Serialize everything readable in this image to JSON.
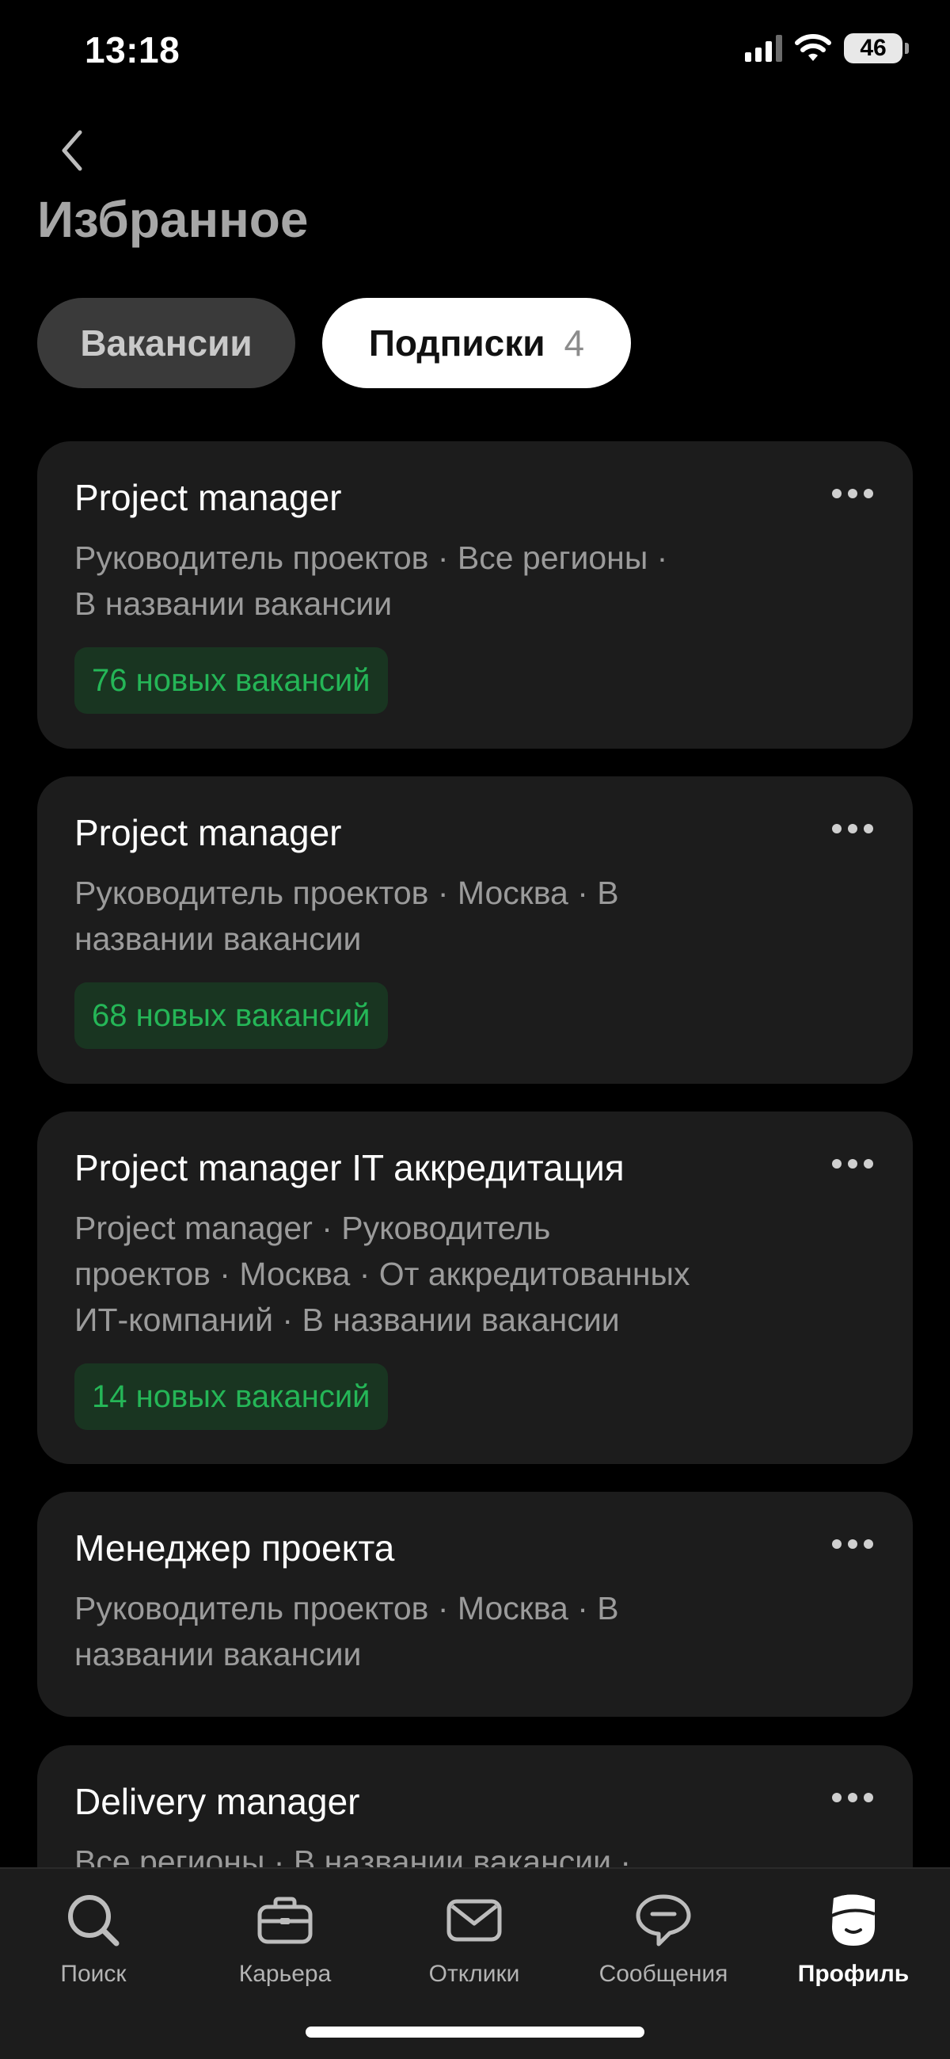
{
  "status_bar": {
    "time": "13:18",
    "battery": "46"
  },
  "header": {
    "back_icon": "chevron-left-icon",
    "title": "Избранное"
  },
  "tabs": [
    {
      "label": "Вакансии",
      "active": false
    },
    {
      "label": "Подписки",
      "count": "4",
      "active": true
    }
  ],
  "subscriptions": [
    {
      "title": "Project manager",
      "desc_lines": [
        "Руководитель проектов · Все регионы ·",
        "В названии вакансии"
      ],
      "badge": "76 новых вакансий"
    },
    {
      "title": "Project manager",
      "desc_lines": [
        "Руководитель проектов · Москва · В",
        "названии вакансии"
      ],
      "badge": "68 новых вакансий"
    },
    {
      "title": "Project manager IT аккредитация",
      "desc_lines": [
        "Project manager · Руководитель",
        "проектов · Москва · От аккредитованных",
        "ИТ-компаний · В названии вакансии"
      ],
      "badge": "14 новых вакансий"
    },
    {
      "title": "Менеджер проекта",
      "desc_lines": [
        "Руководитель проектов · Москва · В",
        "названии вакансии"
      ],
      "badge": null
    },
    {
      "title": "Delivery manager",
      "desc_lines": [
        "Все регионы · В названии вакансии ·"
      ],
      "badge": null
    }
  ],
  "colors": {
    "background": "#000000",
    "card": "#1c1c1c",
    "badge_bg": "#193521",
    "badge_text": "#25b657"
  },
  "bottom_nav": [
    {
      "label": "Поиск",
      "icon": "search-icon",
      "active": false
    },
    {
      "label": "Карьера",
      "icon": "briefcase-icon",
      "active": false
    },
    {
      "label": "Отклики",
      "icon": "envelope-icon",
      "active": false
    },
    {
      "label": "Сообщения",
      "icon": "chat-icon",
      "active": false
    },
    {
      "label": "Профиль",
      "icon": "profile-icon",
      "active": true
    }
  ]
}
